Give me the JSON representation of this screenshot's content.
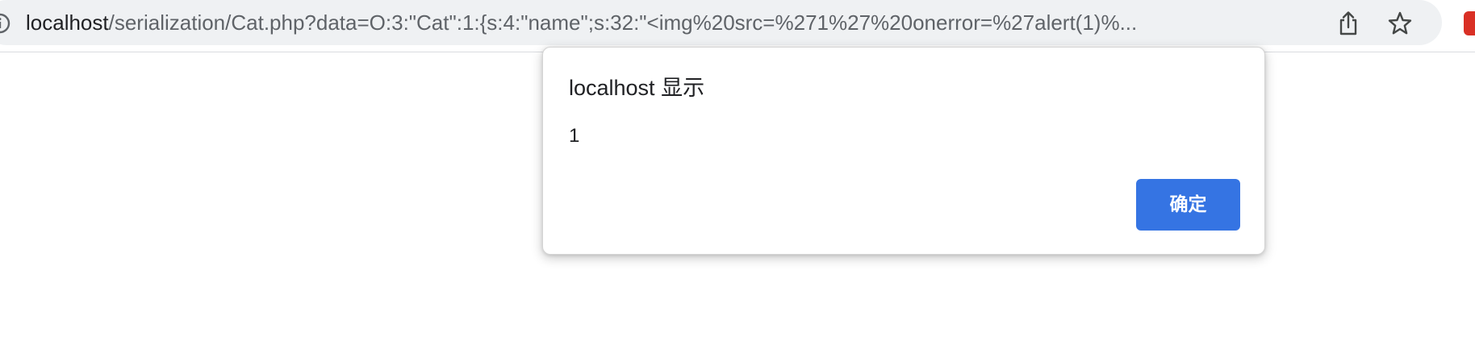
{
  "browser": {
    "url_host": "localhost",
    "url_path": "/serialization/Cat.php?data=O:3:\"Cat\":1:{s:4:\"name\";s:32:\"<img%20src=%271%27%20onerror=%27alert(1)%...",
    "icons": {
      "site_info": "info-icon",
      "share": "share-icon",
      "bookmark": "star-icon",
      "extension": "extension-icon"
    }
  },
  "dialog": {
    "title": "localhost 显示",
    "message": "1",
    "ok_label": "确定",
    "button_color": "#3574e3"
  }
}
